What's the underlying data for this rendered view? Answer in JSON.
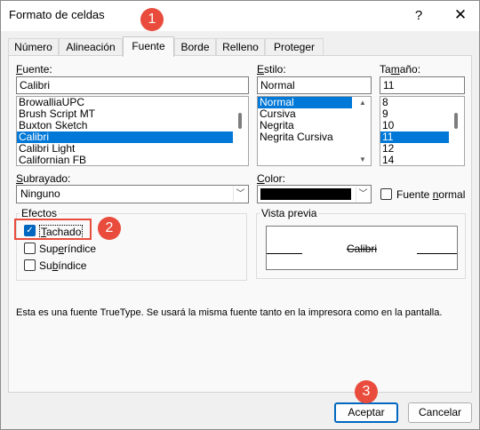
{
  "window": {
    "title": "Formato de celdas",
    "help_symbol": "?",
    "close_symbol": "✕"
  },
  "tabs": [
    {
      "label": "Número"
    },
    {
      "label": "Alineación"
    },
    {
      "label": "Fuente"
    },
    {
      "label": "Borde"
    },
    {
      "label": "Relleno"
    },
    {
      "label": "Proteger"
    }
  ],
  "font": {
    "label_prefix": "F",
    "label_rest": "uente:",
    "value": "Calibri",
    "list": [
      "BrowalliaUPC",
      "Brush Script MT",
      "Buxton Sketch",
      "Calibri",
      "Calibri Light",
      "Californian FB"
    ],
    "selected": "Calibri"
  },
  "style": {
    "label_prefix": "E",
    "label_rest": "stilo:",
    "value": "Normal",
    "list": [
      "Normal",
      "Cursiva",
      "Negrita",
      "Negrita Cursiva"
    ],
    "selected": "Normal"
  },
  "size": {
    "label_prefix": "Ta",
    "label_u": "m",
    "label_rest": "año:",
    "value": "11",
    "list": [
      "8",
      "9",
      "10",
      "11",
      "12",
      "14"
    ],
    "selected": "11"
  },
  "underline": {
    "label_prefix": "S",
    "label_rest": "ubrayado:",
    "value": "Ninguno"
  },
  "color": {
    "label_prefix": "C",
    "label_rest": "olor:",
    "swatch": "#000000"
  },
  "normal_font": {
    "label_a": "Fuente ",
    "label_u": "n",
    "label_b": "ormal",
    "checked": false
  },
  "effects": {
    "title": "Efectos",
    "strikethrough": {
      "label_u": "T",
      "label_rest": "achado",
      "checked": true
    },
    "superscript": {
      "label_a": "Sup",
      "label_u": "e",
      "label_b": "ríndice",
      "checked": false
    },
    "subscript": {
      "label_a": "Su",
      "label_u": "b",
      "label_b": "índice",
      "checked": false
    }
  },
  "preview": {
    "title": "Vista previa",
    "sample": "Calibri"
  },
  "info_text": "Esta es una fuente TrueType. Se usará la misma fuente tanto en la impresora como en la pantalla.",
  "buttons": {
    "accept": "Aceptar",
    "cancel": "Cancelar"
  },
  "annotations": [
    "1",
    "2",
    "3"
  ],
  "colors": {
    "accent": "#0078d7",
    "annotation": "#e94c3c"
  },
  "icons": {
    "check": "✓",
    "dropdown": "﹀",
    "scroll_up": "▲",
    "scroll_down": "▼"
  }
}
